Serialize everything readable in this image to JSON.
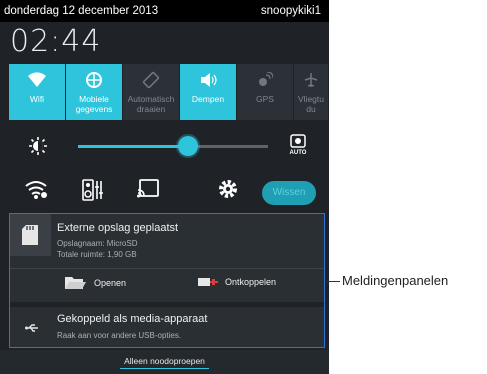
{
  "statusbar": {
    "date": "donderdag 12 december 2013",
    "user": "snoopykiki1"
  },
  "clock": "02:44",
  "toggles": [
    {
      "label": "Wifi",
      "icon": "wifi-icon",
      "on": true
    },
    {
      "label": "Mobiele gegevens",
      "icon": "mobile-data-icon",
      "on": true
    },
    {
      "label": "Automatisch draaien",
      "icon": "rotate-icon",
      "on": false
    },
    {
      "label": "Dempen",
      "icon": "mute-icon",
      "on": true
    },
    {
      "label": "GPS",
      "icon": "gps-icon",
      "on": false
    },
    {
      "label": "Vliegtu du",
      "icon": "airplane-icon",
      "on": false
    }
  ],
  "brightness": {
    "level": 0.58,
    "auto_label": "AUTO"
  },
  "quick_actions": {
    "clear_label": "Wissen"
  },
  "notifications": {
    "storage": {
      "title": "Externe opslag geplaatst",
      "line1": "Opslagnaam: MicroSD",
      "line2": "Totale ruimte: 1,90 GB",
      "open_label": "Openen",
      "eject_label": "Ontkoppelen"
    },
    "usb": {
      "title": "Gekoppeld als media-apparaat",
      "subtitle": "Raak aan voor andere USB-opties."
    }
  },
  "bottom_label": "Alleen noodoproepen",
  "callout_label": "Meldingenpanelen",
  "colors": {
    "accent": "#2ec4db",
    "panel_border": "#2f72d6",
    "background": "#1f2328"
  }
}
